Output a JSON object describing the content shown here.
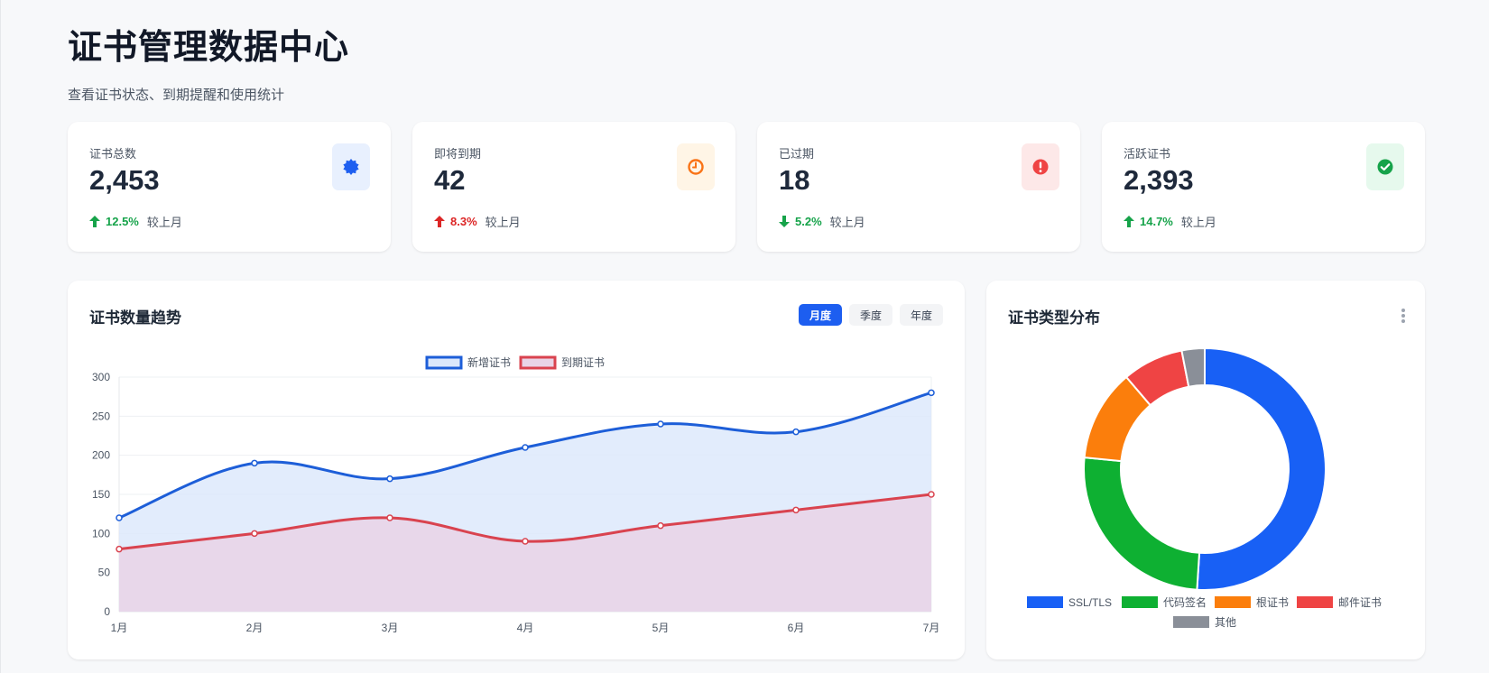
{
  "header": {
    "title": "证书管理数据中心",
    "subtitle": "查看证书状态、到期提醒和使用统计"
  },
  "stats": [
    {
      "label": "证书总数",
      "value": "2,453",
      "change": "12.5%",
      "direction": "up",
      "change_color": "#16a34a",
      "compare": "较上月",
      "icon": "certificate-icon",
      "icon_color": "#1d5ef0",
      "icon_bg": "#e8f0fe"
    },
    {
      "label": "即将到期",
      "value": "42",
      "change": "8.3%",
      "direction": "up",
      "change_color": "#dc2626",
      "compare": "较上月",
      "icon": "clock-icon",
      "icon_color": "#f97316",
      "icon_bg": "#fff5e6"
    },
    {
      "label": "已过期",
      "value": "18",
      "change": "5.2%",
      "direction": "down",
      "change_color": "#16a34a",
      "compare": "较上月",
      "icon": "alert-icon",
      "icon_color": "#ef4444",
      "icon_bg": "#fde8e8"
    },
    {
      "label": "活跃证书",
      "value": "2,393",
      "change": "14.7%",
      "direction": "up",
      "change_color": "#16a34a",
      "compare": "较上月",
      "icon": "check-circle-icon",
      "icon_color": "#16a34a",
      "icon_bg": "#e6f9ed"
    }
  ],
  "trend": {
    "title": "证书数量趋势",
    "periods": [
      "月度",
      "季度",
      "年度"
    ],
    "active_period": "月度"
  },
  "distribution": {
    "title": "证书类型分布"
  },
  "chart_data": [
    {
      "type": "line",
      "x": [
        "1月",
        "2月",
        "3月",
        "4月",
        "5月",
        "6月",
        "7月"
      ],
      "series": [
        {
          "name": "新增证书",
          "values": [
            120,
            190,
            170,
            210,
            240,
            230,
            280
          ],
          "color": "#1d5ed8",
          "fill": "#dbe7fb"
        },
        {
          "name": "到期证书",
          "values": [
            80,
            100,
            120,
            90,
            110,
            130,
            150
          ],
          "color": "#d9434f",
          "fill": "#e9d4e6"
        }
      ],
      "ylim": [
        0,
        300
      ],
      "yticks": [
        "0",
        "50",
        "100",
        "150",
        "200",
        "250",
        "300"
      ],
      "area": true,
      "grid": true,
      "legend": "top-center"
    },
    {
      "type": "pie",
      "donut": true,
      "categories": [
        "SSL/TLS",
        "代码签名",
        "根证书",
        "邮件证书",
        "其他"
      ],
      "values": [
        50,
        25,
        12,
        8,
        3
      ],
      "colors": [
        "#1860f5",
        "#0eb032",
        "#fb7e0c",
        "#ef4444",
        "#8a8f98"
      ],
      "legend": "bottom"
    }
  ]
}
